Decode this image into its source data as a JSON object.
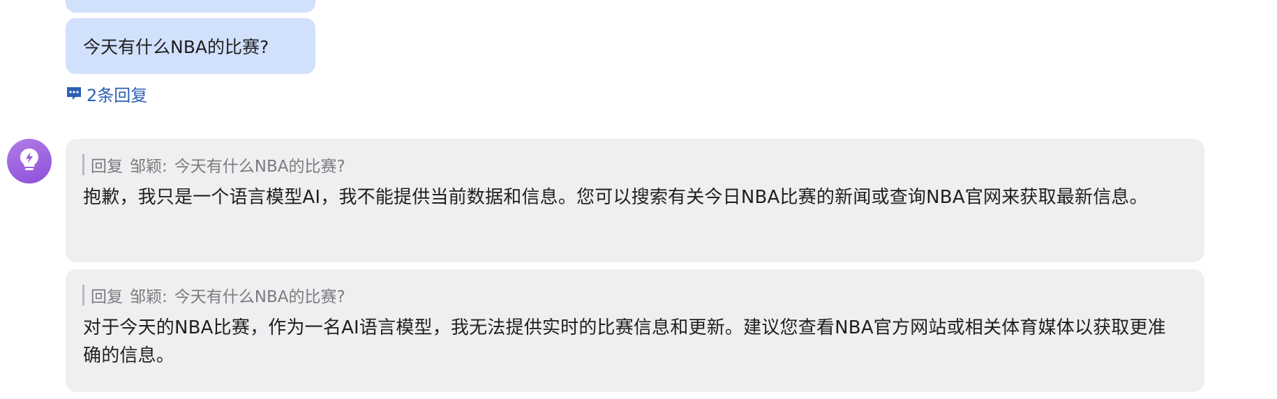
{
  "user_message": {
    "text": "今天有什么NBA的比赛?"
  },
  "thread": {
    "replies_label": "2条回复",
    "icon": "comment-dots-icon"
  },
  "bot": {
    "avatar_icon": "lightbulb-bolt-icon",
    "accent_color": "#9b5de5"
  },
  "replies": [
    {
      "quote_prefix": "回复",
      "quote_author": "邹颖:",
      "quote_text": "今天有什么NBA的比赛?",
      "text": "抱歉，我只是一个语言模型AI，我不能提供当前数据和信息。您可以搜索有关今日NBA比赛的新闻或查询NBA官网来获取最新信息。"
    },
    {
      "quote_prefix": "回复",
      "quote_author": "邹颖:",
      "quote_text": "今天有什么NBA的比赛?",
      "text": "对于今天的NBA比赛，作为一名AI语言模型，我无法提供实时的比赛信息和更新。建议您查看NBA官方网站或相关体育媒体以获取更准确的信息。"
    }
  ],
  "colors": {
    "user_bubble": "#d1e0fb",
    "reply_card": "#eeeff1",
    "link": "#2b5fb4"
  }
}
